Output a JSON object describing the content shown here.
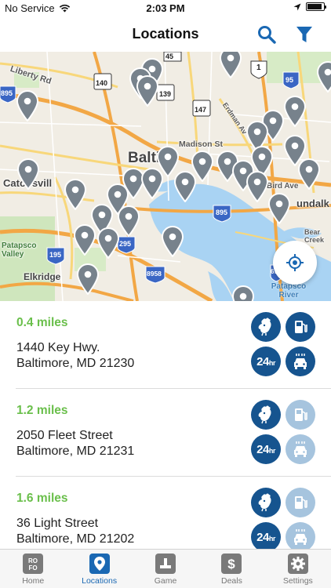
{
  "status_bar": {
    "carrier": "No Service",
    "time": "2:03 PM"
  },
  "nav": {
    "title": "Locations"
  },
  "map": {
    "labels": [
      "Liberty Rd",
      "Madison St",
      "Baltim",
      "Catonsvill",
      "undalk",
      "Bird Ave",
      "Bear Creek",
      "Elkridge",
      "Patapsco Valley",
      "Patapsco River",
      "Erdman Av"
    ],
    "shields": [
      "45",
      "140",
      "1",
      "95",
      "895",
      "139",
      "147",
      "895",
      "195",
      "8958",
      "295",
      "695"
    ]
  },
  "locations": [
    {
      "distance": "0.4 miles",
      "street": "1440 Key Hwy.",
      "city": "Baltimore, MD 21230",
      "amenities": {
        "chicken": true,
        "fuel": true,
        "hours24": true,
        "carwash": true
      }
    },
    {
      "distance": "1.2 miles",
      "street": "2050 Fleet Street",
      "city": "Baltimore, MD 21231",
      "amenities": {
        "chicken": true,
        "fuel": false,
        "hours24": true,
        "carwash": false
      }
    },
    {
      "distance": "1.6 miles",
      "street": "36 Light Street",
      "city": "Baltimore, MD 21202",
      "amenities": {
        "chicken": true,
        "fuel": false,
        "hours24": true,
        "carwash": false
      }
    }
  ],
  "amenity_labels": {
    "hours24": "24",
    "hours24_suffix": "hr"
  },
  "tabs": [
    {
      "label": "Home",
      "icon": "rofo-logo-icon",
      "active": false
    },
    {
      "label": "Locations",
      "icon": "map-pin-icon",
      "active": true
    },
    {
      "label": "Game",
      "icon": "game-icon",
      "active": false
    },
    {
      "label": "Deals",
      "icon": "dollar-tag-icon",
      "active": false
    },
    {
      "label": "Settings",
      "icon": "gear-icon",
      "active": false
    }
  ],
  "colors": {
    "accent": "#1a68b3",
    "amenity_on": "#16548f",
    "amenity_off": "#a6c4de",
    "distance": "#6abf4b",
    "pin": "#77828c"
  }
}
